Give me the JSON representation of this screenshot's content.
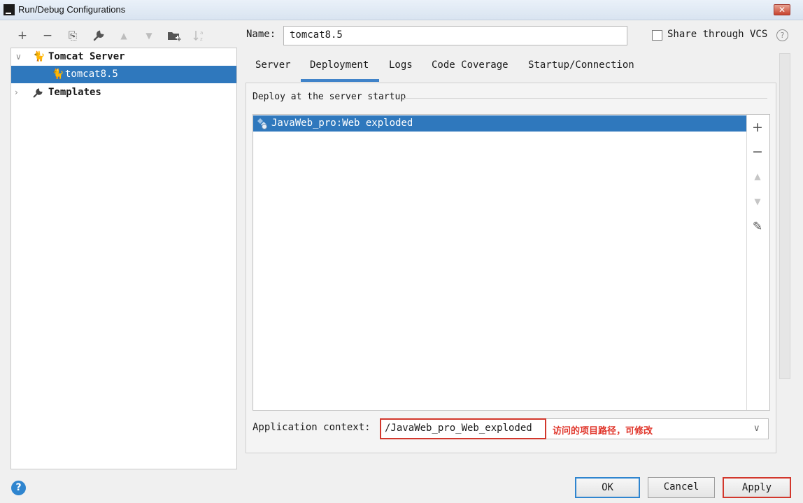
{
  "window": {
    "title": "Run/Debug Configurations",
    "app_icon_text": "IJ",
    "close_glyph": "✕"
  },
  "toolbar": {
    "add": "+",
    "remove": "−",
    "copy": "⎘",
    "edit_defaults": "🔧",
    "move_up": "▲",
    "move_down": "▼",
    "new_folder": "▬",
    "sort": "↓"
  },
  "tree": {
    "items": [
      {
        "label": "Tomcat Server",
        "expanded": true,
        "icon": "tomcat-icon"
      },
      {
        "label": "tomcat8.5",
        "selected": true,
        "icon": "tomcat-icon"
      },
      {
        "label": "Templates",
        "expanded": false,
        "icon": "wrench-icon"
      }
    ]
  },
  "form": {
    "name_label": "Name:",
    "name_value": "tomcat8.5",
    "share_label": "Share through VCS",
    "share_checked": false
  },
  "tabs": [
    {
      "label": "Server",
      "active": false
    },
    {
      "label": "Deployment",
      "active": true
    },
    {
      "label": "Logs",
      "active": false
    },
    {
      "label": "Code Coverage",
      "active": false
    },
    {
      "label": "Startup/Connection",
      "active": false
    }
  ],
  "deployment": {
    "section_title": "Deploy at the server startup",
    "artifacts": [
      "JavaWeb_pro:Web exploded"
    ],
    "side_buttons": {
      "add": "+",
      "remove": "−",
      "up": "▲",
      "down": "▼",
      "edit": "✎"
    },
    "context_label": "Application context:",
    "context_value": "/JavaWeb_pro_Web_exploded",
    "annotation": "访问的项目路径，可修改",
    "dropdown_glyph": "∨"
  },
  "footer": {
    "help": "?",
    "ok": "OK",
    "cancel": "Cancel",
    "apply": "Apply"
  },
  "colors": {
    "selection": "#2f78bd",
    "tab_underline": "#4083c9",
    "highlight_red": "#d2372c",
    "ok_border": "#2f85cf"
  }
}
